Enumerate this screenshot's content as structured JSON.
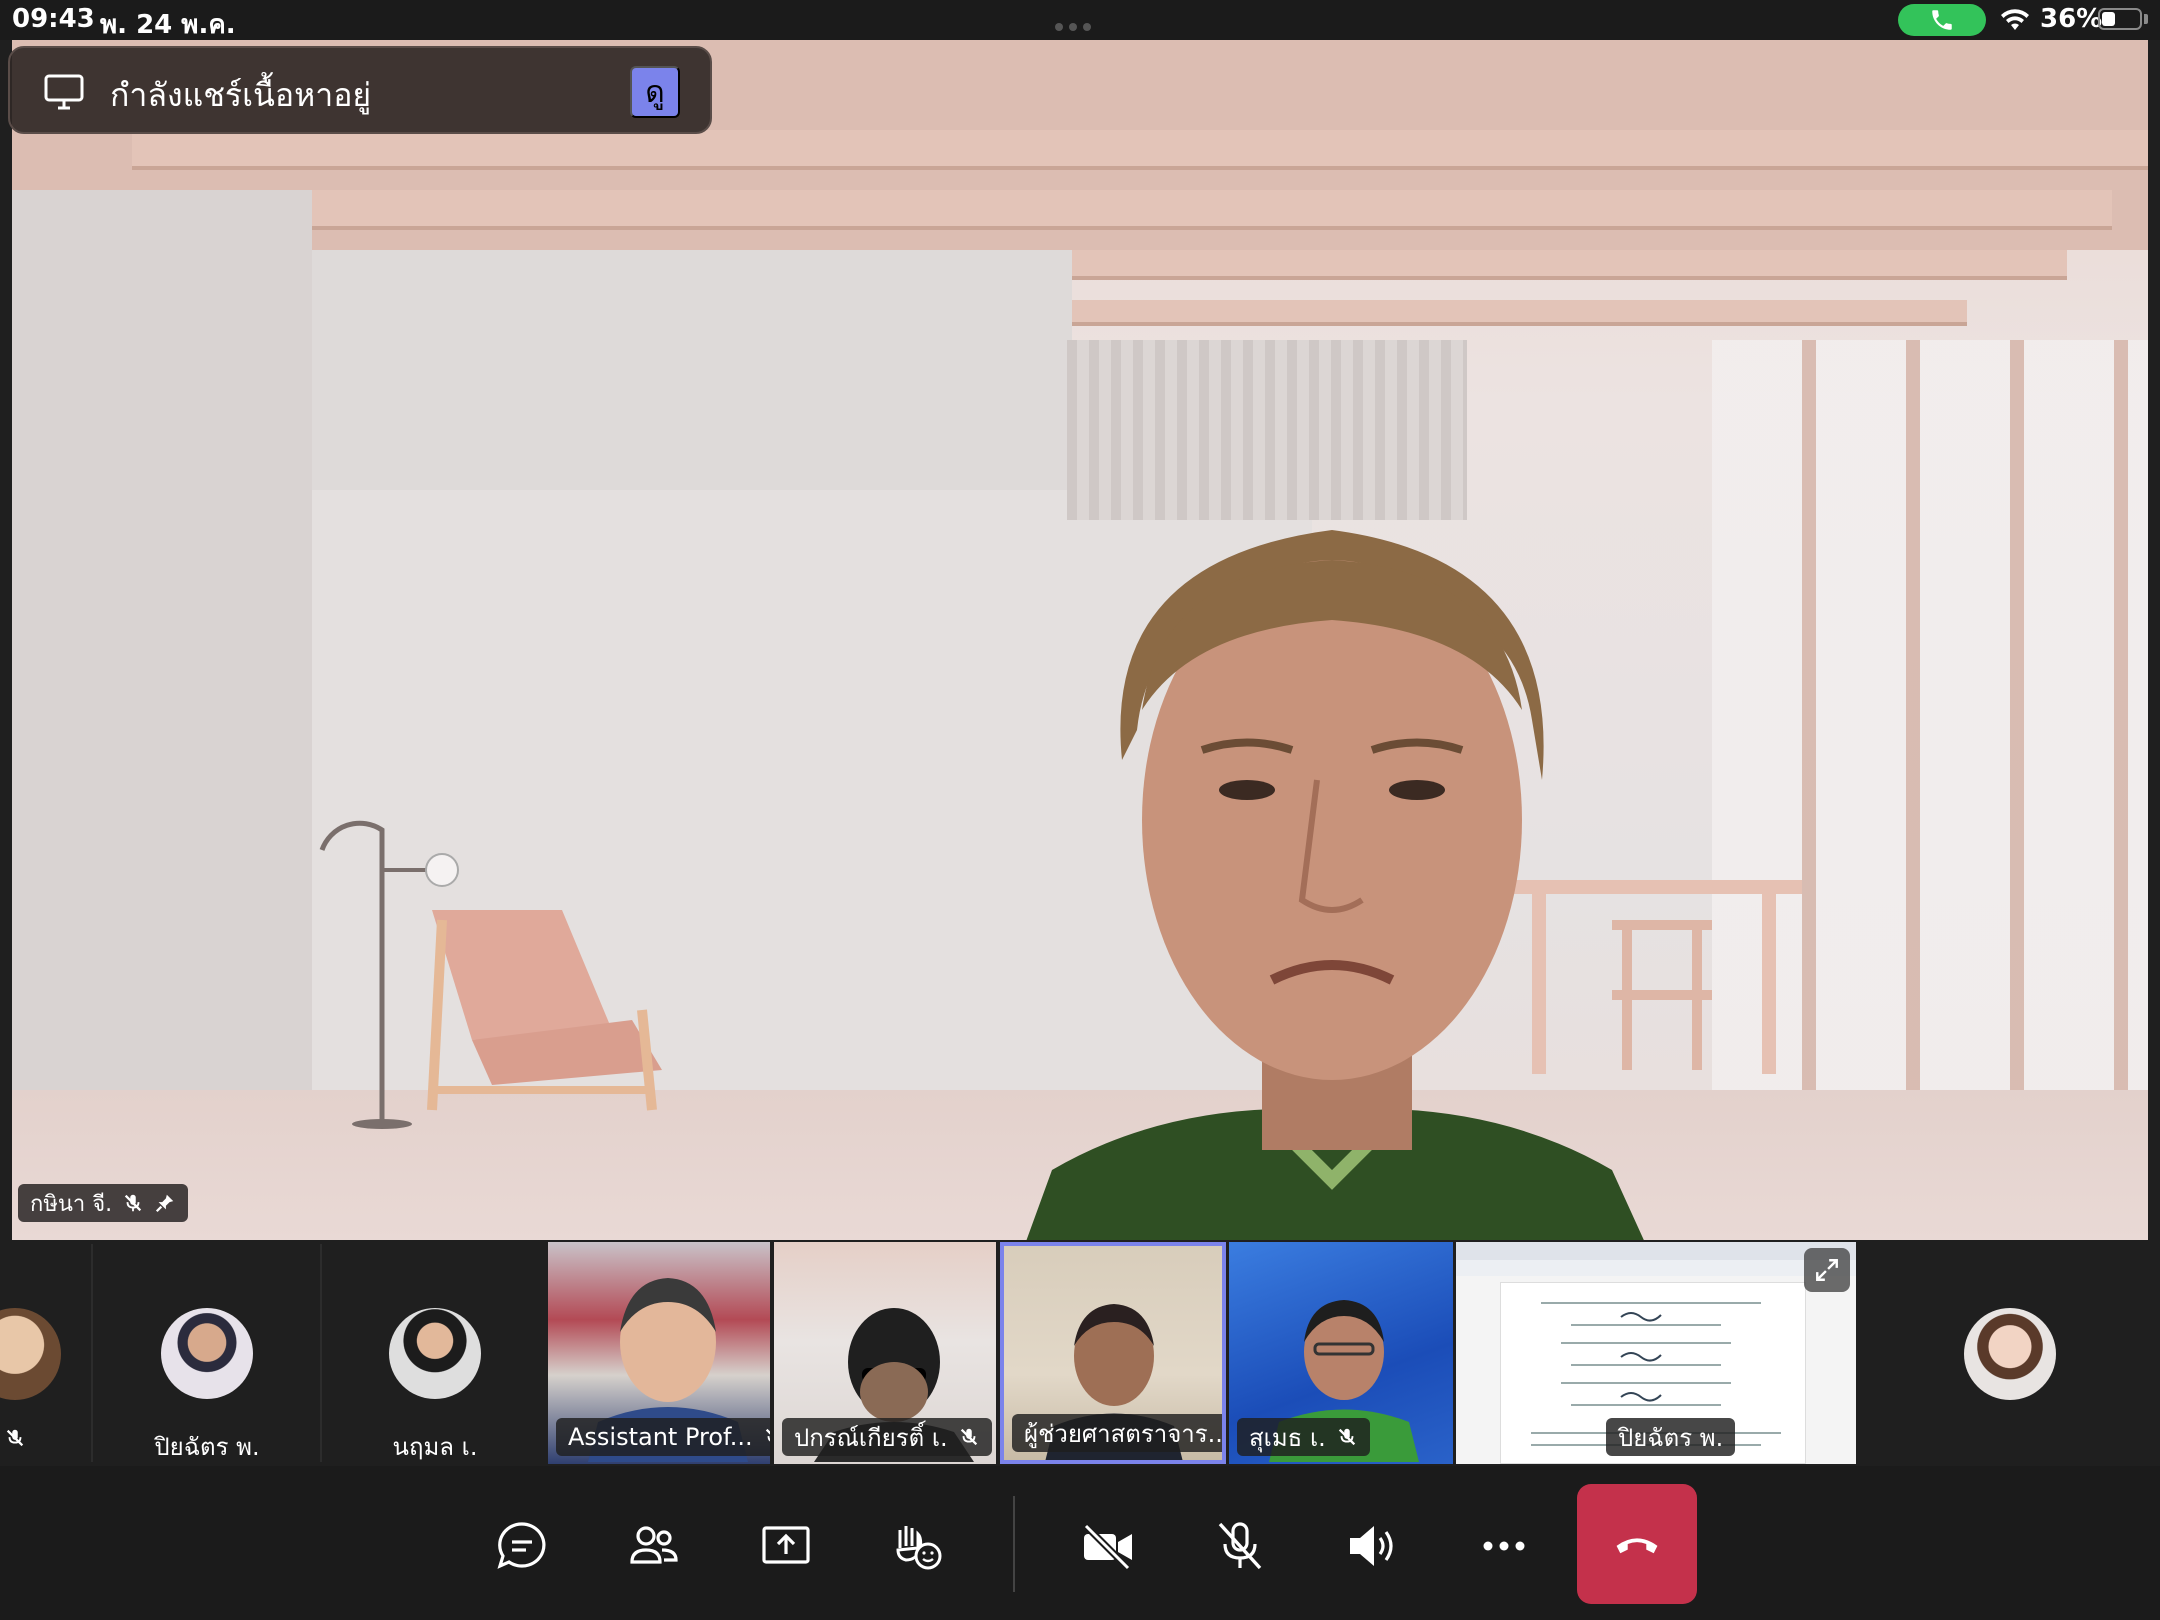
{
  "status": {
    "time": "09:43",
    "date": "พ. 24 พ.ค.",
    "battery": "36%",
    "battery_level": 0.36
  },
  "share_banner": {
    "text": "กำลังแชร์เนื้อหาอยู่",
    "button_label": "ดู"
  },
  "main_speaker": {
    "name": "กษินา จี."
  },
  "participants": {
    "partial_avatar": {
      "name": ""
    },
    "avatar_1": {
      "name": "ปิยฉัตร พ."
    },
    "avatar_2": {
      "name": "นฤมล เ."
    },
    "tiles": [
      {
        "name": "Assistant Prof..."
      },
      {
        "name": "ปกรณ์เกียรติ์ เ."
      },
      {
        "name": "ผู้ช่วยศาสตราจาร..."
      },
      {
        "name": "สุเมธ เ."
      },
      {
        "name": "ปิยฉัตร พ."
      }
    ]
  },
  "colors": {
    "accent": "#7b83eb",
    "end_call": "#c4314b",
    "call_pill": "#33c35a"
  }
}
